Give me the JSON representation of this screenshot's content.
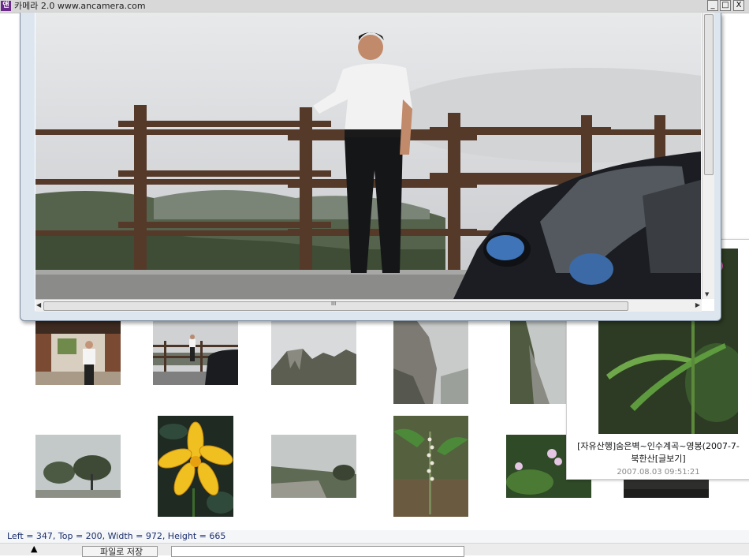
{
  "window": {
    "title": "카메라 2.0 www.ancamera.com",
    "app_icon_label": "앤",
    "minimize_label": "_",
    "maximize_label": "□",
    "close_label": "X"
  },
  "viewer": {
    "photo_alt": "man standing by wooden fence with misty mountains and car",
    "hscroll_grip": "III"
  },
  "thumbnails": [
    {
      "id": "gate-man"
    },
    {
      "id": "fence-car"
    },
    {
      "id": "rocky-ridge"
    },
    {
      "id": "foggy-cliff"
    },
    {
      "id": "foggy-slope"
    },
    {
      "id": "misty-trees"
    },
    {
      "id": "yellow-lily"
    },
    {
      "id": "misty-valley"
    },
    {
      "id": "white-orchid"
    },
    {
      "id": "pink-flowers"
    },
    {
      "id": "dark-slope"
    }
  ],
  "hover_card": {
    "caption_line1": "[자유산행]숨은벽~인수계곡~영봉(2007-7-",
    "caption_line2": "북한산[글보기]",
    "date": "2007.08.03 09:51:21"
  },
  "status": {
    "text": "Left = 347, Top = 200, Width = 972, Height = 665"
  },
  "toolbar": {
    "up_arrow": "▲",
    "save_button_label": "파일로 저장",
    "path_value": ""
  },
  "colors": {
    "status_text": "#1c2f6e",
    "window_frame": "#dde6ef",
    "app_icon": "#6a2a8c"
  }
}
